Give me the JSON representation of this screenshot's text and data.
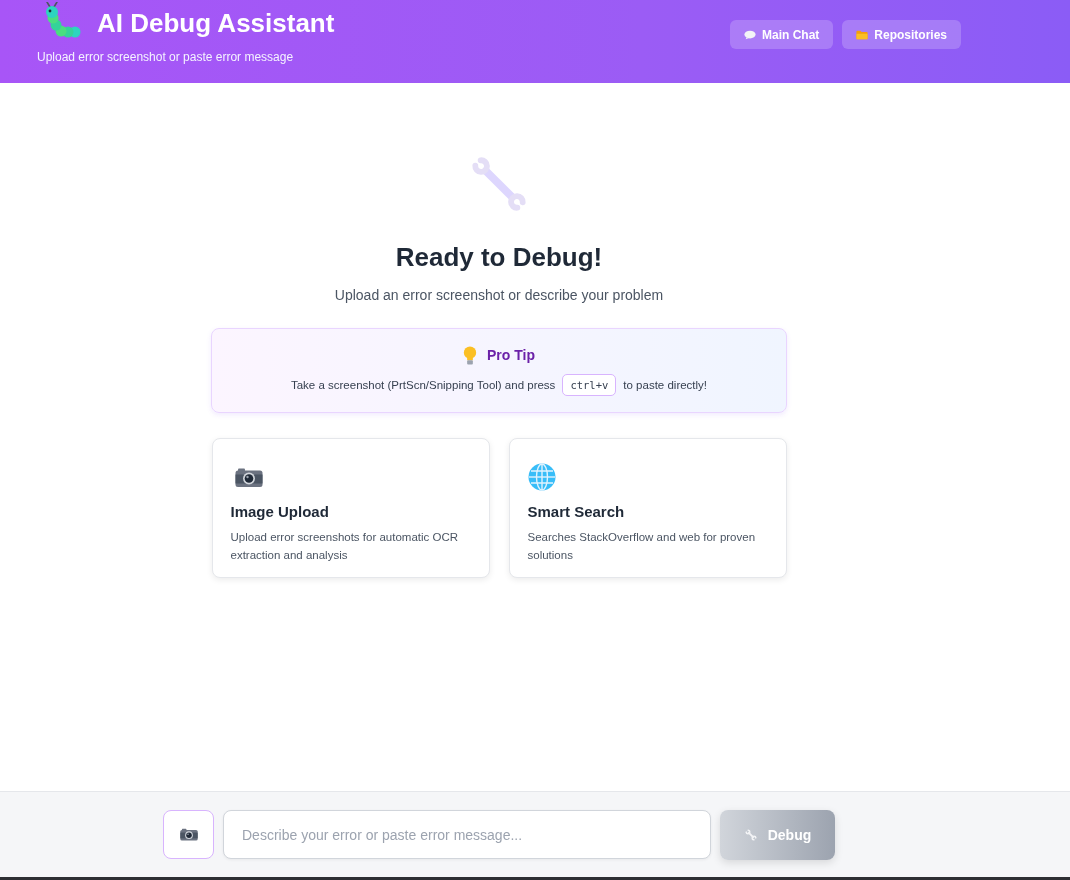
{
  "header": {
    "title": "AI Debug Assistant",
    "subtitle": "Upload error screenshot or paste error message",
    "nav_buttons": [
      {
        "label": "Main Chat",
        "kind": "chat"
      },
      {
        "label": "Repositories",
        "kind": "folder"
      }
    ]
  },
  "welcome": {
    "title": "Ready to Debug!",
    "subtitle": "Upload an error screenshot or describe your problem"
  },
  "pro_tip": {
    "title": "Pro Tip",
    "text_before": "Take a screenshot (PrtScn/Snipping Tool) and press",
    "key": "ctrl+v",
    "text_after": "to paste directly!"
  },
  "features": [
    {
      "kind": "camera",
      "title": "Image Upload",
      "description": "Upload error screenshots for automatic OCR extraction and analysis"
    },
    {
      "kind": "globe",
      "title": "Smart Search",
      "description": "Searches StackOverflow and web for proven solutions"
    }
  ],
  "composer": {
    "placeholder": "Describe your error or paste error message...",
    "submit": {
      "label": "Debug",
      "disabled": true
    }
  }
}
